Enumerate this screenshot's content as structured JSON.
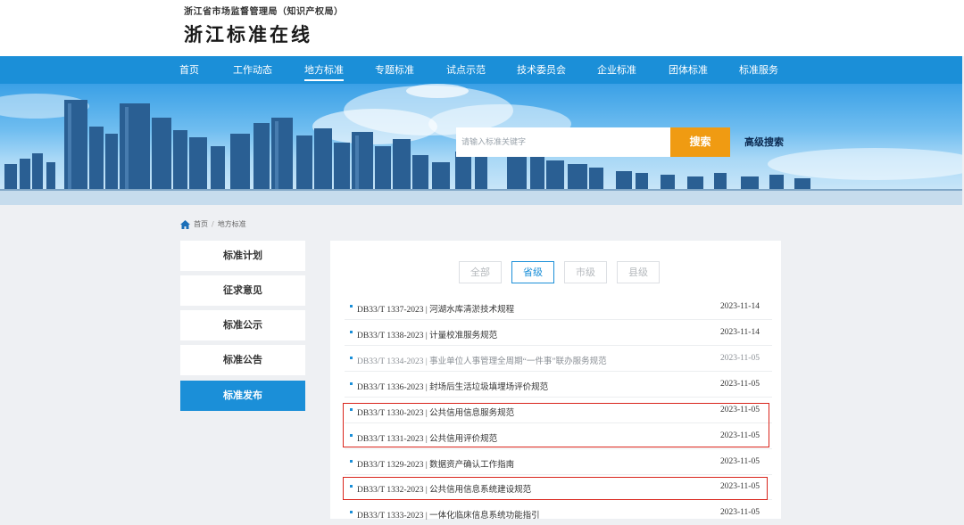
{
  "header": {
    "org_name": "浙江省市场监督管理局（知识产权局）",
    "site_title": "浙江标准在线"
  },
  "nav": {
    "items": [
      {
        "label": "首页"
      },
      {
        "label": "工作动态"
      },
      {
        "label": "地方标准"
      },
      {
        "label": "专题标准"
      },
      {
        "label": "试点示范"
      },
      {
        "label": "技术委员会"
      },
      {
        "label": "企业标准"
      },
      {
        "label": "团体标准"
      },
      {
        "label": "标准服务"
      }
    ],
    "active": "地方标准"
  },
  "search": {
    "placeholder": "请输入标准关键字",
    "button_label": "搜索",
    "advanced_label": "高级搜索"
  },
  "breadcrumb": {
    "home": "首页",
    "separator": "/",
    "current": "地方标准"
  },
  "sidebar": {
    "items": [
      {
        "label": "标准计划"
      },
      {
        "label": "征求意见"
      },
      {
        "label": "标准公示"
      },
      {
        "label": "标准公告"
      },
      {
        "label": "标准发布"
      }
    ],
    "active": "标准发布"
  },
  "filters": {
    "items": [
      {
        "label": "全部"
      },
      {
        "label": "省级"
      },
      {
        "label": "市级"
      },
      {
        "label": "县级"
      }
    ],
    "active": "省级"
  },
  "standards": [
    {
      "title": "DB33/T 1337-2023 | 河湖水库清淤技术规程",
      "date": "2023-11-14"
    },
    {
      "title": "DB33/T 1338-2023 | 计量校准服务规范",
      "date": "2023-11-14"
    },
    {
      "title": "DB33/T 1334-2023 | 事业单位人事管理全周期“一件事”联办服务规范",
      "date": "2023-11-05"
    },
    {
      "title": "DB33/T 1336-2023 | 封场后生活垃圾填埋场评价规范",
      "date": "2023-11-05"
    },
    {
      "title": "DB33/T 1330-2023 | 公共信用信息服务规范",
      "date": "2023-11-05"
    },
    {
      "title": "DB33/T 1331-2023 | 公共信用评价规范",
      "date": "2023-11-05"
    },
    {
      "title": "DB33/T 1329-2023 | 数据资产确认工作指南",
      "date": "2023-11-05"
    },
    {
      "title": "DB33/T 1332-2023 | 公共信用信息系统建设规范",
      "date": "2023-11-05"
    },
    {
      "title": "DB33/T 1333-2023 | 一体化临床信息系统功能指引",
      "date": "2023-11-05"
    }
  ],
  "colors": {
    "primary": "#1b8fd8",
    "search_button": "#f09b12",
    "highlight_border": "#d9251c"
  }
}
